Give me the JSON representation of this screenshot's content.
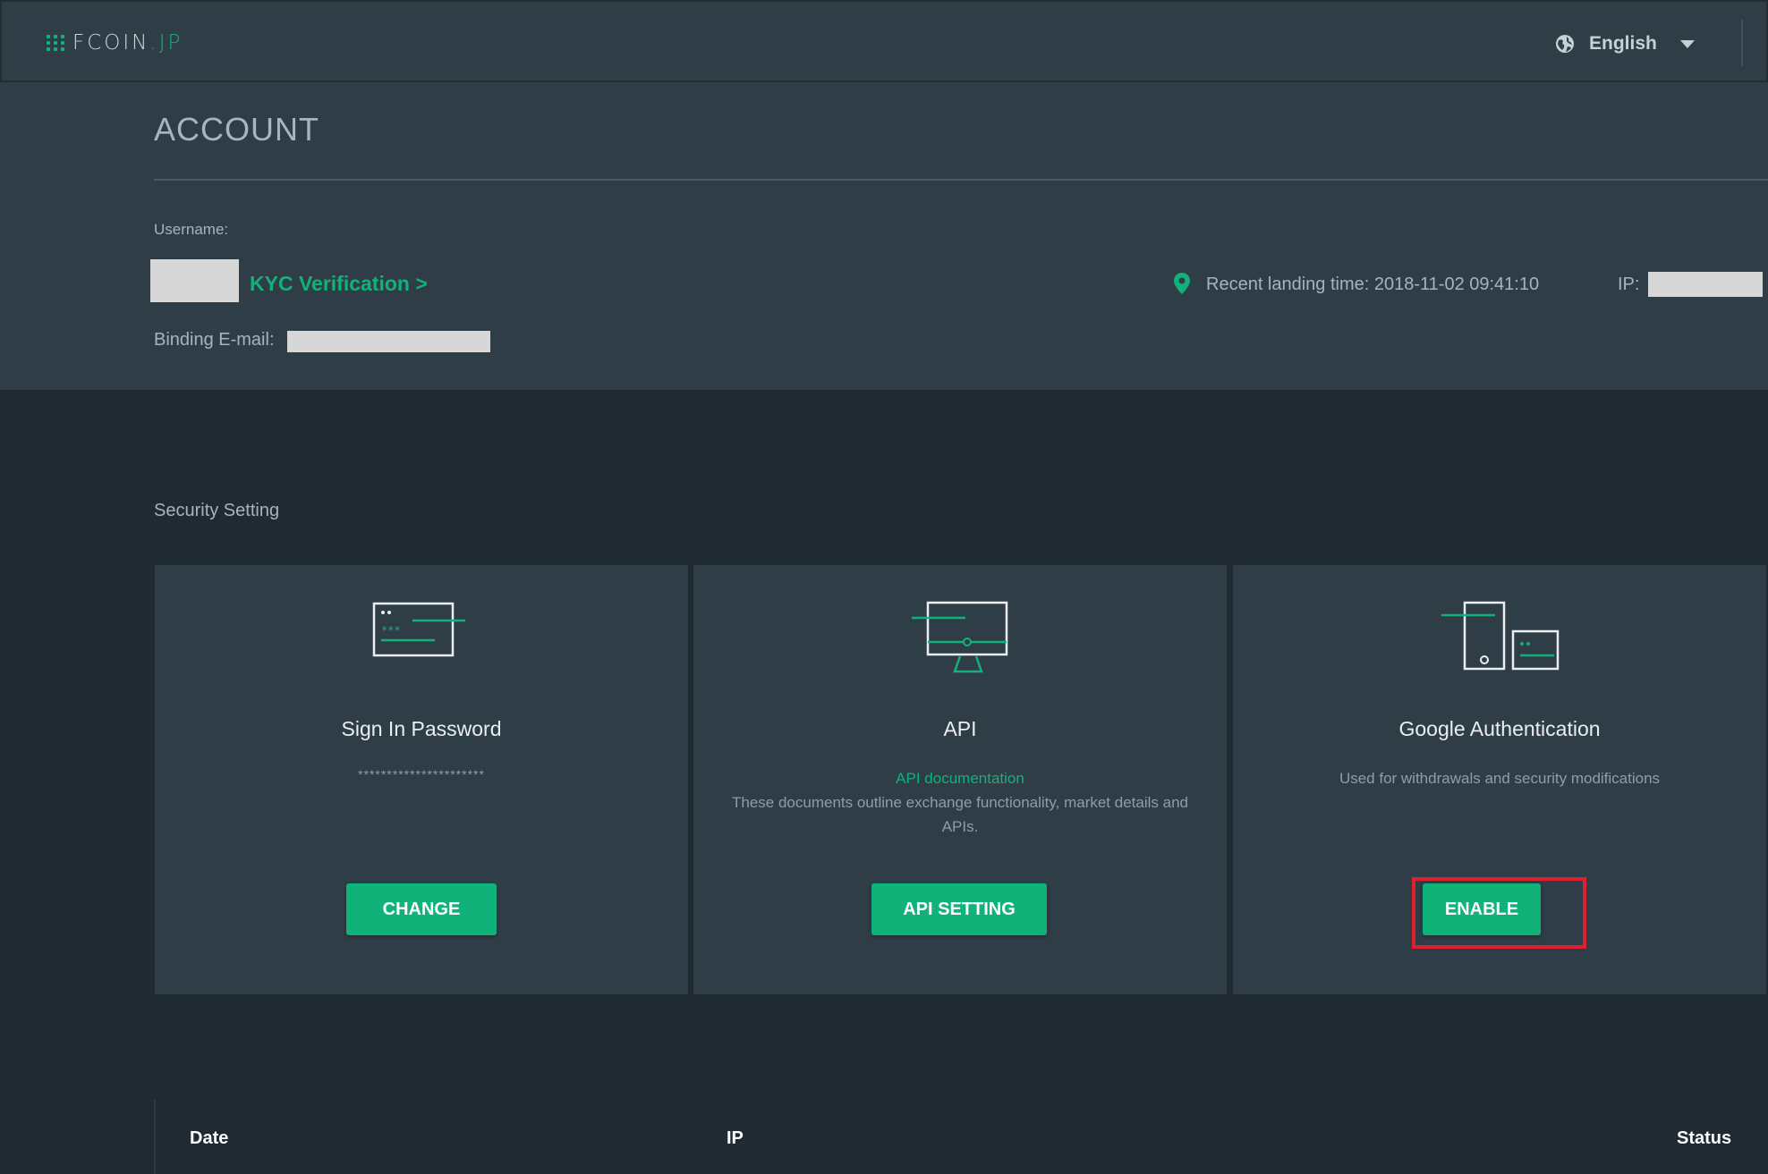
{
  "header": {
    "logo_text": "FCOIN",
    "logo_suffix": ".JP",
    "language": "English"
  },
  "account": {
    "title": "ACCOUNT",
    "username_label": "Username:",
    "kyc_link": "KYC Verification >",
    "recent_landing": "Recent landing time: 2018-11-02 09:41:10",
    "ip_label": "IP:",
    "email_label": "Binding E-mail:"
  },
  "security": {
    "title": "Security Setting",
    "cards": [
      {
        "title": "Sign In Password",
        "masked_password": "**********************",
        "button": "CHANGE"
      },
      {
        "title": "API",
        "link": "API documentation",
        "description": "These documents outline exchange functionality, market details and APIs.",
        "button": "API SETTING"
      },
      {
        "title": "Google Authentication",
        "description": "Used for withdrawals and security modifications",
        "button": "ENABLE"
      }
    ]
  },
  "table": {
    "columns": [
      "Date",
      "IP",
      "Status"
    ]
  },
  "colors": {
    "accent": "#11b27a",
    "highlight": "#e0202b",
    "panel": "#2f3d46",
    "background": "#1f2a33"
  },
  "icons": {
    "logo": "dot-grid-icon",
    "language": "globe-icon",
    "dropdown": "caret-down-icon",
    "location": "location-pin-icon",
    "password_card": "password-card-icon",
    "api_card": "monitor-icon",
    "auth_card": "phone-device-icon"
  }
}
